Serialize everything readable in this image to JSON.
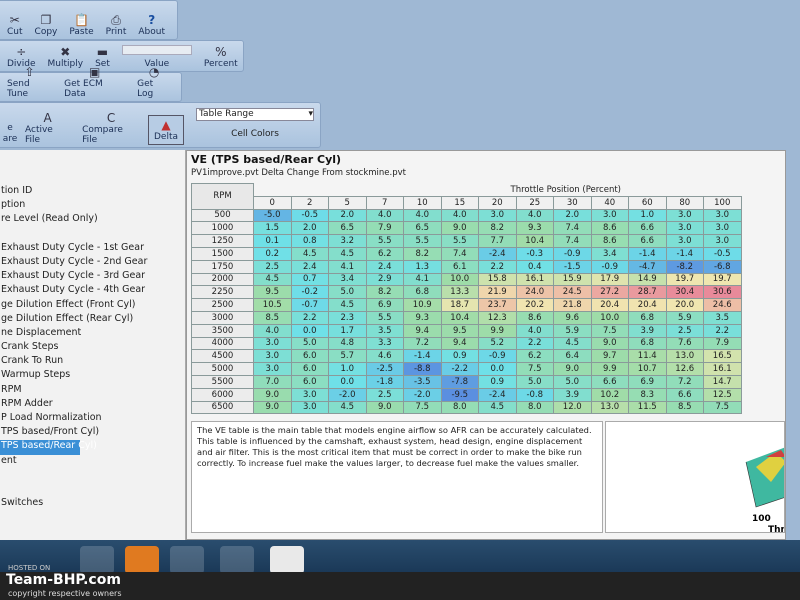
{
  "toolbar": {
    "row1": [
      {
        "label": "Cut",
        "icon": "scissors-icon"
      },
      {
        "label": "Copy",
        "icon": "copy-icon"
      },
      {
        "label": "Paste",
        "icon": "paste-icon"
      },
      {
        "label": "Print",
        "icon": "printer-icon"
      },
      {
        "label": "About",
        "icon": "help-icon"
      }
    ],
    "row2": [
      {
        "label": "Divide",
        "icon": "divide-icon"
      },
      {
        "label": "Multiply",
        "icon": "multiply-icon"
      },
      {
        "label": "Set",
        "icon": "set-icon"
      },
      {
        "label": "Value",
        "icon": "spinner-icon"
      },
      {
        "label": "Percent",
        "icon": "percent-icon"
      }
    ],
    "row3": [
      {
        "label": "Send Tune",
        "icon": "send-icon"
      },
      {
        "label": "Get ECM Data",
        "icon": "ecm-icon"
      },
      {
        "label": "Get Log",
        "icon": "log-icon"
      }
    ],
    "row4": [
      {
        "label": "Active File",
        "icon": "file-a-icon"
      },
      {
        "label": "Compare File",
        "icon": "file-c-icon"
      },
      {
        "label": "Delta",
        "icon": "delta-icon"
      }
    ],
    "cell_colors_select": "Table Range",
    "cell_colors_label": "Cell Colors",
    "left_partial": [
      "e",
      "are"
    ]
  },
  "tree": {
    "items": [
      "tion ID",
      "ption",
      "re Level (Read Only)",
      "",
      "Exhaust Duty Cycle - 1st Gear",
      "Exhaust Duty Cycle - 2nd Gear",
      "Exhaust Duty Cycle - 3rd Gear",
      "Exhaust Duty Cycle - 4th Gear",
      "ge Dilution Effect (Front Cyl)",
      "ge Dilution Effect (Rear Cyl)",
      "ne Displacement",
      "Crank Steps",
      "Crank To Run",
      "Warmup Steps",
      "RPM",
      "RPM Adder",
      "P Load Normalization",
      "TPS based/Front Cyl)",
      "TPS based/Rear Cyl)",
      "ent",
      "",
      "",
      "Switches"
    ],
    "selected_index": 18
  },
  "main": {
    "title": "VE (TPS based/Rear Cyl)",
    "subtitle": "PV1improve.pvt Delta Change From stockmine.pvt",
    "axis_label": "Throttle Position (Percent)",
    "row_header": "RPM",
    "columns": [
      "0",
      "2",
      "5",
      "7",
      "10",
      "15",
      "20",
      "25",
      "30",
      "40",
      "60",
      "80",
      "100"
    ],
    "rows": [
      {
        "rpm": "500",
        "v": [
          "-5.0",
          "-0.5",
          "2.0",
          "4.0",
          "4.0",
          "4.0",
          "3.0",
          "4.0",
          "2.0",
          "3.0",
          "1.0",
          "3.0",
          "3.0"
        ]
      },
      {
        "rpm": "1000",
        "v": [
          "1.5",
          "2.0",
          "6.5",
          "7.9",
          "6.5",
          "9.0",
          "8.2",
          "9.3",
          "7.4",
          "8.6",
          "6.6",
          "3.0",
          "3.0"
        ]
      },
      {
        "rpm": "1250",
        "v": [
          "0.1",
          "0.8",
          "3.2",
          "5.5",
          "5.5",
          "5.5",
          "7.7",
          "10.4",
          "7.4",
          "8.6",
          "6.6",
          "3.0",
          "3.0"
        ]
      },
      {
        "rpm": "1500",
        "v": [
          "0.2",
          "4.5",
          "4.5",
          "6.2",
          "8.2",
          "7.4",
          "-2.4",
          "-0.3",
          "-0.9",
          "3.4",
          "-1.4",
          "-1.4",
          "-0.5"
        ]
      },
      {
        "rpm": "1750",
        "v": [
          "2.5",
          "2.4",
          "4.1",
          "2.4",
          "1.3",
          "6.1",
          "2.2",
          "0.4",
          "-1.5",
          "-0.9",
          "-4.7",
          "-8.2",
          "-6.8"
        ]
      },
      {
        "rpm": "2000",
        "v": [
          "4.5",
          "0.7",
          "3.4",
          "2.9",
          "4.1",
          "10.0",
          "15.8",
          "16.1",
          "15.9",
          "17.9",
          "14.9",
          "19.7",
          "19.7"
        ]
      },
      {
        "rpm": "2250",
        "v": [
          "9.5",
          "-0.2",
          "5.0",
          "8.2",
          "6.8",
          "13.3",
          "21.9",
          "24.0",
          "24.5",
          "27.2",
          "28.7",
          "30.4",
          "30.6"
        ]
      },
      {
        "rpm": "2500",
        "v": [
          "10.5",
          "-0.7",
          "4.5",
          "6.9",
          "10.9",
          "18.7",
          "23.7",
          "20.2",
          "21.8",
          "20.4",
          "20.4",
          "20.0",
          "24.6"
        ]
      },
      {
        "rpm": "3000",
        "v": [
          "8.5",
          "2.2",
          "2.3",
          "5.5",
          "9.3",
          "10.4",
          "12.3",
          "8.6",
          "9.6",
          "10.0",
          "6.8",
          "5.9",
          "3.5"
        ]
      },
      {
        "rpm": "3500",
        "v": [
          "4.0",
          "0.0",
          "1.7",
          "3.5",
          "9.4",
          "9.5",
          "9.9",
          "4.0",
          "5.9",
          "7.5",
          "3.9",
          "2.5",
          "2.2"
        ]
      },
      {
        "rpm": "4000",
        "v": [
          "3.0",
          "5.0",
          "4.8",
          "3.3",
          "7.2",
          "9.4",
          "5.2",
          "2.2",
          "4.5",
          "9.0",
          "6.8",
          "7.6",
          "7.9"
        ]
      },
      {
        "rpm": "4500",
        "v": [
          "3.0",
          "6.0",
          "5.7",
          "4.6",
          "-1.4",
          "0.9",
          "-0.9",
          "6.2",
          "6.4",
          "9.7",
          "11.4",
          "13.0",
          "16.5"
        ]
      },
      {
        "rpm": "5000",
        "v": [
          "3.0",
          "6.0",
          "1.0",
          "-2.5",
          "-8.8",
          "-2.2",
          "0.0",
          "7.5",
          "9.0",
          "9.9",
          "10.7",
          "12.6",
          "16.1"
        ]
      },
      {
        "rpm": "5500",
        "v": [
          "7.0",
          "6.0",
          "0.0",
          "-1.8",
          "-3.5",
          "-7.8",
          "0.9",
          "5.0",
          "5.0",
          "6.6",
          "6.9",
          "7.2",
          "14.7"
        ]
      },
      {
        "rpm": "6000",
        "v": [
          "9.0",
          "3.0",
          "-2.0",
          "2.5",
          "-2.0",
          "-9.5",
          "-2.4",
          "-0.8",
          "3.9",
          "10.2",
          "8.3",
          "6.6",
          "12.5"
        ]
      },
      {
        "rpm": "6500",
        "v": [
          "9.0",
          "3.0",
          "4.5",
          "9.0",
          "7.5",
          "8.0",
          "4.5",
          "8.0",
          "12.0",
          "13.0",
          "11.5",
          "8.5",
          "7.5"
        ]
      }
    ],
    "color_scale": {
      "min_color": "#5b8fe0",
      "low_color": "#6fe0e8",
      "mid_color": "#9edca8",
      "high_color": "#f0e6b0",
      "max_color": "#e88a9a"
    },
    "description": "The VE table is the main table that models engine airflow so AFR can be accurately calculated.  This table is influenced by the camshaft, exhaust system, head design, engine displacement and air filter. This is the most critical item that must be correct in order to make the bike run correctly. To increase fuel make the values larger, to decrease fuel make the values smaller.",
    "chart_axis_partial": [
      "100",
      "Thrott"
    ]
  },
  "watermark": {
    "brand": "Team-BHP.com",
    "sub": "copyright respective owners",
    "hosted": "HOSTED ON"
  }
}
